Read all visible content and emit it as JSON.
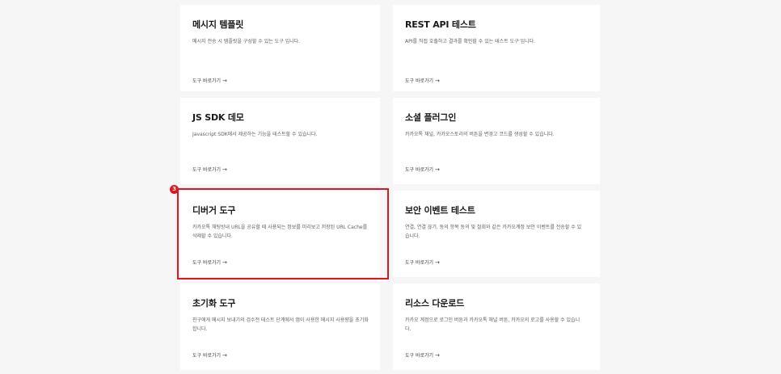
{
  "cards": [
    {
      "title": "메시지 템플릿",
      "description": "메시지 전송 시 템플릿을 구성할 수 있는 도구 입니다.",
      "link": "도구 바로가기"
    },
    {
      "title": "REST API 테스트",
      "description": "API를 직접 호출하고 결과를 확인할 수 있는 테스트 도구 입니다.",
      "link": "도구 바로가기"
    },
    {
      "title": "JS SDK 데모",
      "description": "Javascript SDK에서 제공하는 기능을 테스트할 수 있습니다.",
      "link": "도구 바로가기"
    },
    {
      "title": "소셜 플러그인",
      "description": "카카오톡 채널, 카카오스토리의 버튼을 변경고 코드를 생성할 수 있습니다.",
      "link": "도구 바로가기"
    },
    {
      "title": "디버거 도구",
      "description": "카카오톡 채팅방내 URL을 공유할 때 사용되는 정보를 미리보고 저장된 URL Cache를 삭제할 수 있습니다.",
      "link": "도구 바로가기"
    },
    {
      "title": "보안 이벤트 테스트",
      "description": "연결, 연결 끊기, 동의 항목 동의 및 철회와 같은 카카오계정 보안 이벤트를 전송할 수 있습니다.",
      "link": "도구 바로가기"
    },
    {
      "title": "초기화 도구",
      "description": "친구에게 메시지 보내기의 검수전 테스트 단계에서 앱이 사용한 메시지 사용량을 초기화합니다.",
      "link": "도구 바로가기"
    },
    {
      "title": "리소스 다운로드",
      "description": "카카오 계정으로 로그인 버튼과 카카오톡 채널 버튼, 카카오의 로고를 사용할 수 있습니다.",
      "link": "도구 바로가기"
    }
  ],
  "annotation": {
    "marker_label": "3",
    "color": "#e0161f"
  },
  "link_arrow": "→"
}
